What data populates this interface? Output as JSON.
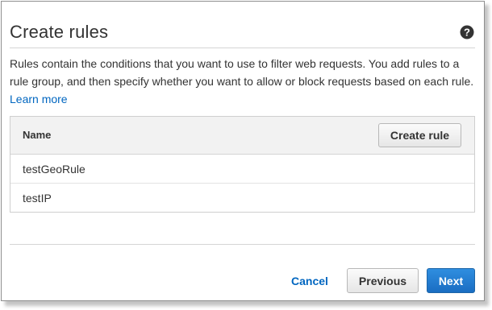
{
  "dialog": {
    "title": "Create rules",
    "help_icon": "question-circle-icon",
    "description_prefix": "Rules contain the conditions that you want to use to filter web requests. You add rules to a rule group, and then specify whether you want to allow or block requests based on each rule. ",
    "learn_more_label": "Learn more"
  },
  "rules_table": {
    "column_name": "Name",
    "create_rule_label": "Create rule",
    "rows": [
      {
        "name": "testGeoRule"
      },
      {
        "name": "testIP"
      }
    ]
  },
  "footer": {
    "cancel_label": "Cancel",
    "previous_label": "Previous",
    "next_label": "Next"
  },
  "colors": {
    "link": "#0066c0",
    "primary_button": "#1a6dc2",
    "text": "#333333"
  }
}
